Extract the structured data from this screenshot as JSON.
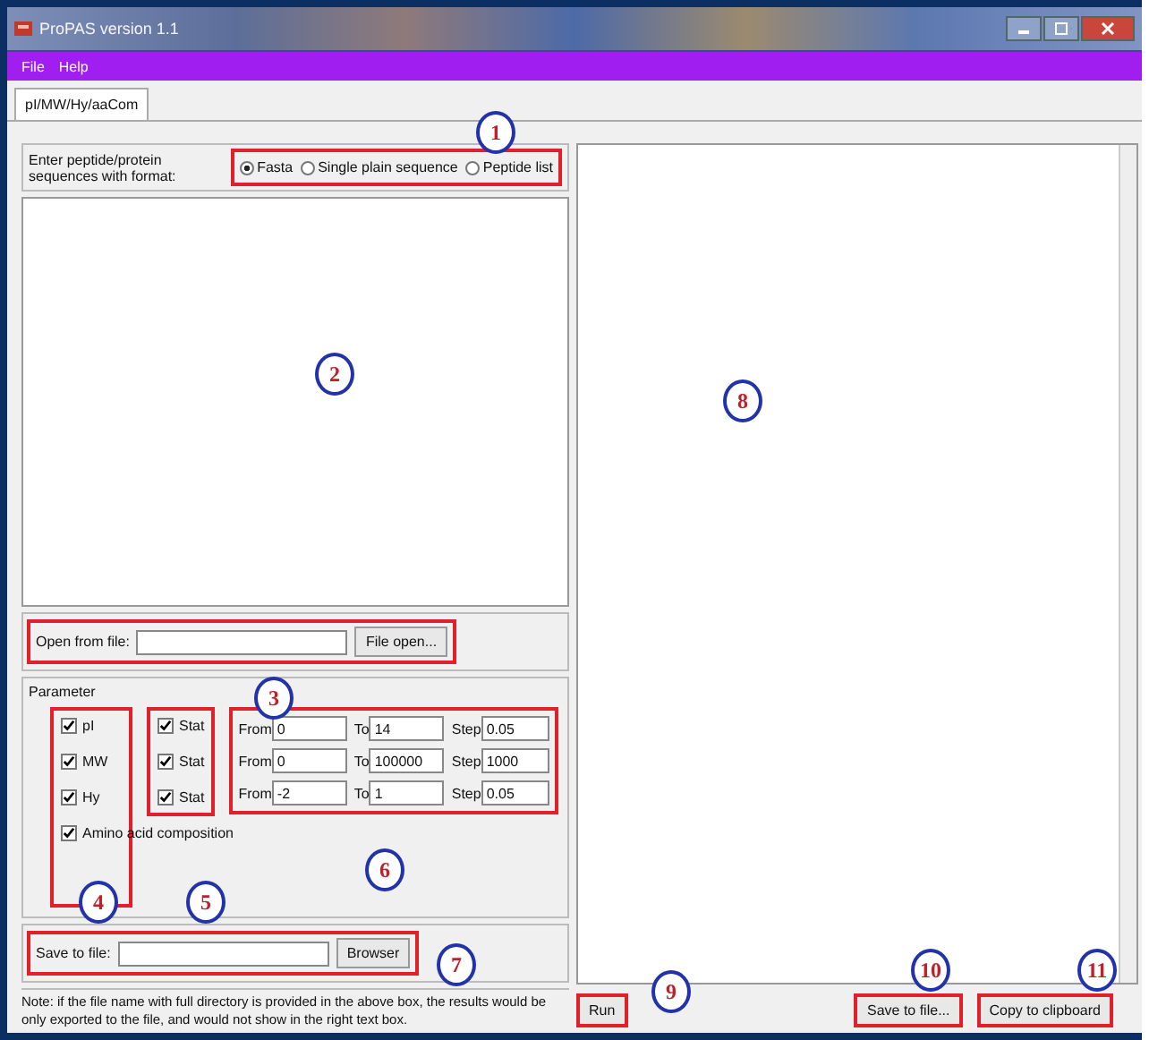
{
  "window": {
    "title": "ProPAS version 1.1"
  },
  "menu": [
    "File",
    "Help"
  ],
  "tabs": [
    {
      "label": "pI/MW/Hy/aaCom",
      "selected": true
    }
  ],
  "format": {
    "label": "Enter peptide/protein sequences with format:",
    "options": [
      {
        "label": "Fasta",
        "selected": true
      },
      {
        "label": "Single plain sequence",
        "selected": false
      },
      {
        "label": "Peptide list",
        "selected": false
      }
    ]
  },
  "open_file": {
    "label": "Open from file:",
    "button": "File open..."
  },
  "parameter": {
    "title": "Parameter",
    "rows": [
      {
        "label": "pI",
        "checked": true,
        "stat": "Stat",
        "stat_checked": true,
        "from_label": "From",
        "from": "0",
        "to_label": "To",
        "to": "14",
        "step_label": "Step",
        "step": "0.05"
      },
      {
        "label": "MW",
        "checked": true,
        "stat": "Stat",
        "stat_checked": true,
        "from_label": "From",
        "from": "0",
        "to_label": "To",
        "to": "100000",
        "step_label": "Step",
        "step": "1000"
      },
      {
        "label": "Hy",
        "checked": true,
        "stat": "Stat",
        "stat_checked": true,
        "from_label": "From",
        "from": "-2",
        "to_label": "To",
        "to": "1",
        "step_label": "Step",
        "step": "0.05"
      }
    ],
    "amino": {
      "label": "Amino acid composition",
      "checked": true
    }
  },
  "save_file": {
    "label": "Save to file:",
    "button": "Browser"
  },
  "note": "Note: if the file name with full directory is provided in the above box, the results would be only exported to the file, and would not show in the right text box.",
  "buttons": {
    "run": "Run",
    "save": "Save to file...",
    "copy": "Copy to clipboard"
  },
  "callouts": [
    "1",
    "2",
    "3",
    "4",
    "5",
    "6",
    "7",
    "8",
    "9",
    "10",
    "11"
  ]
}
